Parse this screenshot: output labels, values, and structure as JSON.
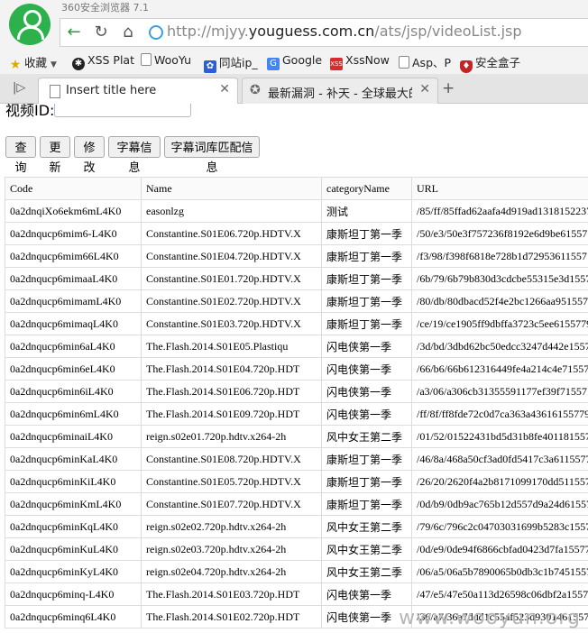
{
  "browser": {
    "app_title": "360安全浏览器 7.1",
    "url_prefix": "http://mjyy.",
    "url_domain": "youguess.com.cn",
    "url_path": "/ats/jsp/videoList.jsp"
  },
  "bookmarks": [
    {
      "label": "收藏",
      "icon": "star-icon"
    },
    {
      "label": "XSS Plat",
      "icon": "xss-icon"
    },
    {
      "label": "WooYu",
      "icon": "page-icon"
    },
    {
      "label": "同站ip_",
      "icon": "paw-icon"
    },
    {
      "label": "Google",
      "icon": "google-icon"
    },
    {
      "label": "XssNow",
      "icon": "xss-icon"
    },
    {
      "label": "Asp、P",
      "icon": "page-icon"
    },
    {
      "label": "安全盒子",
      "icon": "shield-icon"
    }
  ],
  "tabs": [
    {
      "label": "Insert title here",
      "active": true
    },
    {
      "label": "最新漏洞 - 补天 - 全球最大的漏",
      "active": false
    }
  ],
  "page": {
    "video_id_label": "视频ID:",
    "buttons": [
      "查询",
      "更新",
      "修改",
      "字幕信息",
      "字幕词库匹配信息"
    ],
    "table": {
      "headers": [
        "Code",
        "Name",
        "categoryName",
        "URL"
      ],
      "rows": [
        [
          "0a2dnqiXo6ekm6mL4K0",
          "easonlzg",
          "测试",
          "/85/ff/85ffad62aafa4d919ad1318152237"
        ],
        [
          "0a2dnqucp6mim6-L4K0",
          "Constantine.S01E06.720p.HDTV.X",
          "康斯坦丁第一季",
          "/50/e3/50e3f757236f8192e6d9be61557"
        ],
        [
          "0a2dnqucp6mim66L4K0",
          "Constantine.S01E04.720p.HDTV.X",
          "康斯坦丁第一季",
          "/f3/98/f398f6818e728b1d72953611557"
        ],
        [
          "0a2dnqucp6mimaaL4K0",
          "Constantine.S01E01.720p.HDTV.X",
          "康斯坦丁第一季",
          "/6b/79/6b79b830d3cdcbe55315e3d1557"
        ],
        [
          "0a2dnqucp6mimamL4K0",
          "Constantine.S01E02.720p.HDTV.X",
          "康斯坦丁第一季",
          "/80/db/80dbacd52f4e2bc1266aa951557"
        ],
        [
          "0a2dnqucp6mimaqL4K0",
          "Constantine.S01E03.720p.HDTV.X",
          "康斯坦丁第一季",
          "/ce/19/ce1905ff9dbffa3723c5ee6155779"
        ],
        [
          "0a2dnqucp6min6aL4K0",
          "The.Flash.2014.S01E05.Plastiqu",
          "闪电侠第一季",
          "/3d/bd/3dbd62bc50edcc3247d442e1557"
        ],
        [
          "0a2dnqucp6min6eL4K0",
          "The.Flash.2014.S01E04.720p.HDT",
          "闪电侠第一季",
          "/66/b6/66b612316449fe4a214c4e71557"
        ],
        [
          "0a2dnqucp6min6iL4K0",
          "The.Flash.2014.S01E06.720p.HDT",
          "闪电侠第一季",
          "/a3/06/a306cb31355591177ef39f71557"
        ],
        [
          "0a2dnqucp6min6mL4K0",
          "The.Flash.2014.S01E09.720p.HDT",
          "闪电侠第一季",
          "/ff/8f/ff8fde72c0d7ca363a43616155779"
        ],
        [
          "0a2dnqucp6minaiL4K0",
          "reign.s02e01.720p.hdtv.x264-2h",
          "风中女王第二季",
          "/01/52/01522431bd5d31b8fe401181557"
        ],
        [
          "0a2dnqucp6minKaL4K0",
          "Constantine.S01E08.720p.HDTV.X",
          "康斯坦丁第一季",
          "/46/8a/468a50cf3ad0fd5417c3a6115577"
        ],
        [
          "0a2dnqucp6minKiL4K0",
          "Constantine.S01E05.720p.HDTV.X",
          "康斯坦丁第一季",
          "/26/20/2620f4a2b8171099170dd511557"
        ],
        [
          "0a2dnqucp6minKmL4K0",
          "Constantine.S01E07.720p.HDTV.X",
          "康斯坦丁第一季",
          "/0d/b9/0db9ac765b12d557d9a24d61557"
        ],
        [
          "0a2dnqucp6minKqL4K0",
          "reign.s02e02.720p.hdtv.x264-2h",
          "风中女王第二季",
          "/79/6c/796c2c04703031699b5283c1557"
        ],
        [
          "0a2dnqucp6minKuL4K0",
          "reign.s02e03.720p.hdtv.x264-2h",
          "风中女王第二季",
          "/0d/e9/0de94f6866cbfad0423d7fa15577"
        ],
        [
          "0a2dnqucp6minKyL4K0",
          "reign.s02e04.720p.hdtv.x264-2h",
          "风中女王第二季",
          "/06/a5/06a5b7890065b0db3c1b7451557"
        ],
        [
          "0a2dnqucp6minq-L4K0",
          "The.Flash.2014.S01E03.720p.HDT",
          "闪电侠第一季",
          "/47/e5/47e50a113d26598c06dbf2a1557"
        ],
        [
          "0a2dnqucp6minq6L4K0",
          "The.Flash.2014.S01E02.720p.HDT",
          "闪电侠第一季",
          "/36/a7/36a7ddd1c55af523d9301461557"
        ]
      ]
    }
  },
  "watermark": "www.wooyun.org"
}
